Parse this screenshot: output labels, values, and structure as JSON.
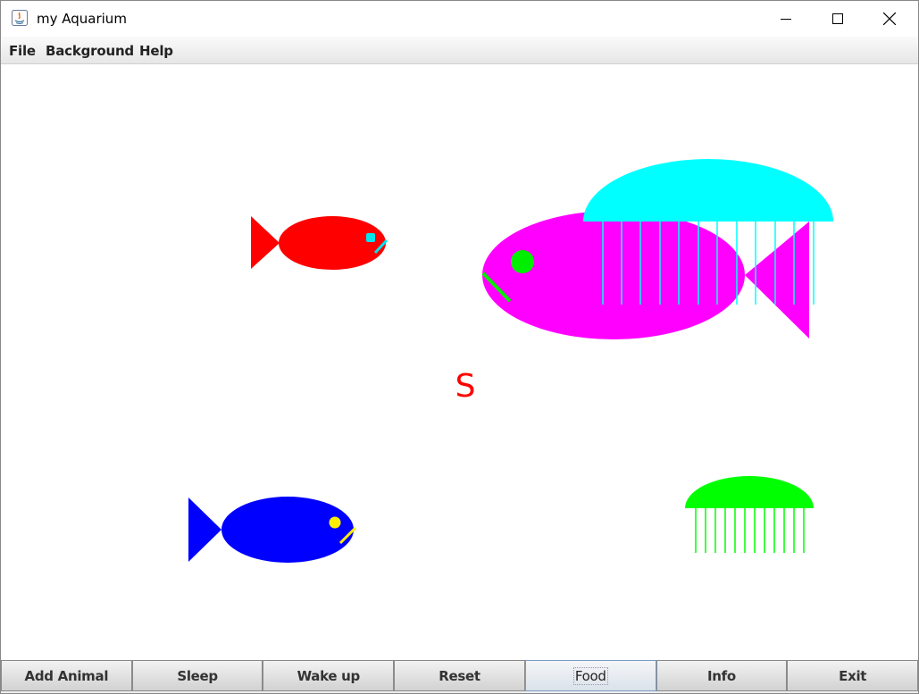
{
  "window": {
    "title": "my Aquarium",
    "controls": [
      "minimize",
      "maximize",
      "close"
    ]
  },
  "menu": {
    "items": [
      {
        "label": "File"
      },
      {
        "label": "Background"
      },
      {
        "label": "Help"
      }
    ]
  },
  "canvas": {
    "fish": [
      {
        "body_color": "#ff0000",
        "eye_color": "#00e5ee",
        "mouth_color": "#00e5ee",
        "facing": "right"
      },
      {
        "body_color": "#ff00ff",
        "eye_color": "#00ee00",
        "mouth_color": "#00ee00",
        "facing": "left"
      },
      {
        "body_color": "#0000ff",
        "eye_color": "#ffee00",
        "mouth_color": "#ffee00",
        "facing": "right"
      }
    ],
    "jellyfish": [
      {
        "color": "#00ffff"
      },
      {
        "color": "#00ff00"
      }
    ],
    "food": {
      "label": "S",
      "color": "#ff0000"
    }
  },
  "buttons": [
    {
      "label": "Add Animal",
      "focused": false
    },
    {
      "label": "Sleep",
      "focused": false
    },
    {
      "label": "Wake up",
      "focused": false
    },
    {
      "label": "Reset",
      "focused": false
    },
    {
      "label": "Food",
      "focused": true
    },
    {
      "label": "Info",
      "focused": false
    },
    {
      "label": "Exit",
      "focused": false
    }
  ]
}
